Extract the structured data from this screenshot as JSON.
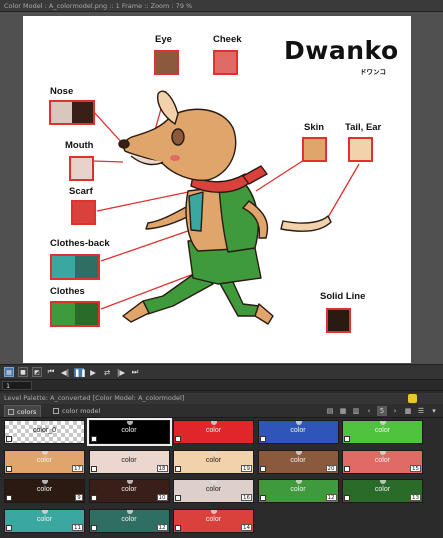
{
  "window": {
    "title": "Color Model : A_colormodel.png  ::  1 Frame  ::  Zoom : 79 %"
  },
  "canvas": {
    "title": "Dwanko",
    "title_kana": "ドワンコ",
    "labels": {
      "eye": "Eye",
      "cheek": "Cheek",
      "nose": "Nose",
      "mouth": "Mouth",
      "scarf": "Scarf",
      "clothes_back": "Clothes-back",
      "clothes": "Clothes",
      "skin": "Skin",
      "tail_ear": "Tail, Ear",
      "solid_line": "Solid Line"
    },
    "swatch_colors": {
      "eye": "#8b5a3c",
      "cheek": "#e06a64",
      "nose_a": "#d9c6bd",
      "nose_b": "#3a1f18",
      "mouth": "#e8d2cc",
      "scarf": "#d9423c",
      "clothes_back_a": "#3aa8a0",
      "clothes_back_b": "#2f6e63",
      "clothes_a": "#3e9a3a",
      "clothes_b": "#2a6b2a",
      "skin": "#e0a56a",
      "tail_ear": "#f2d2aa",
      "solid_line": "#2a1a12"
    }
  },
  "transport": {
    "buttons": [
      "first-frame",
      "prev-key",
      "pause",
      "play",
      "loop",
      "next-key",
      "last-frame"
    ]
  },
  "frame": {
    "value": "1"
  },
  "palette": {
    "header": "Level Palette: A_converted    [Color Model: A_colormodel]",
    "tabs": [
      {
        "label": "colors"
      },
      {
        "label": "color model"
      }
    ],
    "chips": [
      {
        "name": "color_0",
        "num": "",
        "color": "checker",
        "dark": true
      },
      {
        "name": "color",
        "num": "",
        "color": "#000000",
        "selected": true
      },
      {
        "name": "color",
        "num": "",
        "color": "#e0252b"
      },
      {
        "name": "color",
        "num": "",
        "color": "#2f55b8"
      },
      {
        "name": "color",
        "num": "",
        "color": "#4fc23e"
      },
      {
        "name": "color",
        "num": "17",
        "color": "#e0a56a"
      },
      {
        "name": "color",
        "num": "18",
        "color": "#ecd7cf",
        "dark": true
      },
      {
        "name": "color",
        "num": "19",
        "color": "#f2d2aa",
        "dark": true
      },
      {
        "name": "color",
        "num": "20",
        "color": "#8b5a3c"
      },
      {
        "name": "color",
        "num": "15",
        "color": "#e06a64"
      },
      {
        "name": "color",
        "num": "9",
        "color": "#2a1a12"
      },
      {
        "name": "color",
        "num": "10",
        "color": "#3a1f18"
      },
      {
        "name": "color",
        "num": "16",
        "color": "#ddd0ca",
        "dark": true
      },
      {
        "name": "color",
        "num": "12",
        "color": "#3e9a3a"
      },
      {
        "name": "color",
        "num": "13",
        "color": "#2a6b2a"
      },
      {
        "name": "color",
        "num": "11",
        "color": "#3aa8a0"
      },
      {
        "name": "color",
        "num": "12",
        "color": "#2f6e63"
      },
      {
        "name": "color",
        "num": "14",
        "color": "#d9423c"
      }
    ]
  }
}
